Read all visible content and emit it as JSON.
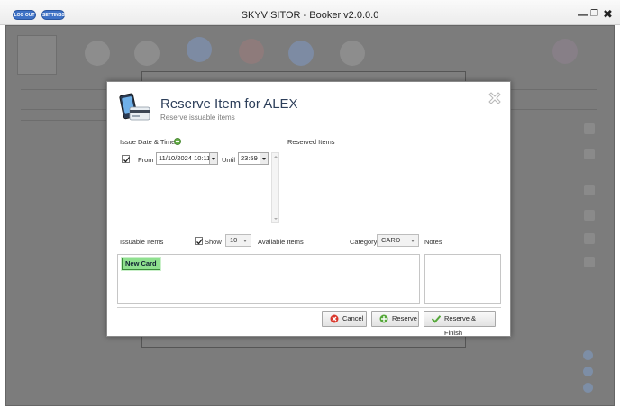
{
  "window": {
    "title": "SKYVISITOR - Booker v2.0.0.0",
    "logout_label": "LOG OUT",
    "settings_label": "SETTINGS"
  },
  "dialog": {
    "title": "Reserve Item for ALEX",
    "subtitle": "Reserve issuable items",
    "issue_date_label": "Issue Date & Time",
    "from_label": "From",
    "from_value": "11/10/2024 10:11",
    "from_checked": true,
    "until_label": "Until",
    "until_value": "23:59",
    "reserved_items_label": "Reserved Items",
    "issuable_items_label": "Issuable Items",
    "show_label": "Show",
    "show_checked": true,
    "show_count": "10",
    "available_items_label": "Available Items",
    "category_label": "Category",
    "category_value": "CARD",
    "notes_label": "Notes",
    "items": [
      "New Card"
    ],
    "buttons": {
      "cancel": "Cancel",
      "reserve": "Reserve",
      "reserve_finish": "Reserve & Finish"
    }
  },
  "colors": {
    "accent": "#3f72c6",
    "title_text": "#2d3f5a",
    "item_highlight": "#8fe08f",
    "overlay": "#7c7c7c"
  }
}
